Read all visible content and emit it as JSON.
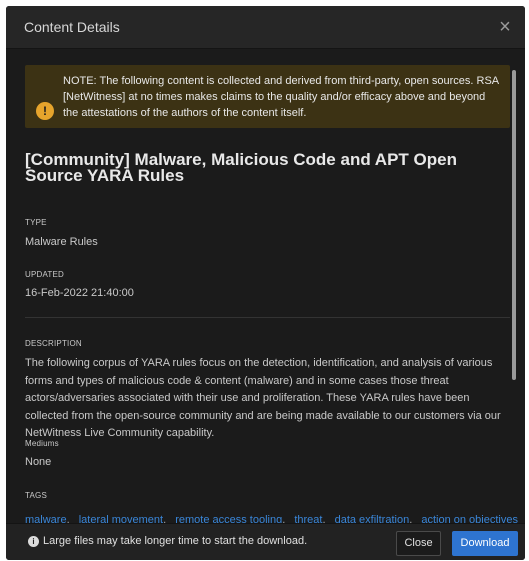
{
  "header": {
    "title": "Content Details",
    "close_glyph": "×",
    "close_icon": "close-icon"
  },
  "notice": {
    "icon": "warning-icon",
    "icon_glyph": "!",
    "text": "NOTE: The following content is collected and derived from third-party, open sources. RSA [NetWitness] at no times makes claims to the quality and/or efficacy above and beyond the attestations of the authors of the content itself."
  },
  "content": {
    "title": "[Community] Malware, Malicious Code and APT Open Source YARA Rules",
    "type_label": "TYPE",
    "type_value": "Malware Rules",
    "updated_label": "UPDATED",
    "updated_value": "16-Feb-2022 21:40:00",
    "description_label": "DESCRIPTION",
    "description": "The following corpus of YARA rules focus on the detection, identification, and analysis of various forms and types of malicious code & content (malware) and in some cases those threat actors/adversaries associated with their use and proliferation. These YARA rules have been collected from the open-source community and are being made available to our customers via our NetWitness Live Community capability.",
    "mediums_label": "Mediums",
    "mediums_value": "None",
    "tags_label": "TAGS",
    "tags": [
      "malware",
      "lateral movement",
      "remote access tooling",
      "threat",
      "data exfiltration",
      "action on objectives"
    ]
  },
  "footer": {
    "info_icon": "info-icon",
    "info_glyph": "i",
    "message": "Large files may take longer time to start the download.",
    "close_label": "Close",
    "download_label": "Download"
  },
  "colors": {
    "background": "#1b1b1b",
    "header": "#262626",
    "notice_bg": "#3c3214",
    "warning": "#e6a42c",
    "accent": "#2e74d0",
    "tag_link": "#3a86d8"
  }
}
